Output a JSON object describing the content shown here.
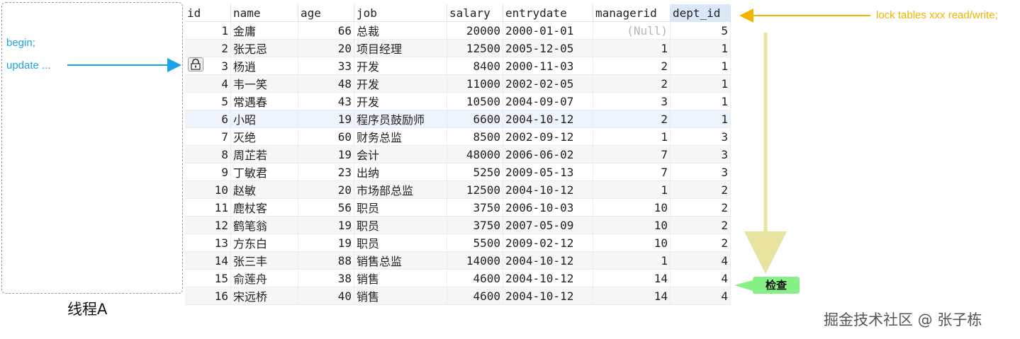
{
  "thread": {
    "label": "线程A",
    "notes": [
      "begin;",
      "update ..."
    ]
  },
  "annotation": {
    "lock_text": "lock tables xxx read/write;",
    "check_label": "检查"
  },
  "watermark": "掘金技术社区 @ 张子栋",
  "colors": {
    "thread_note": "#1aa3e8",
    "lock_arrow": "#f1b400",
    "check_arrow": "#e8e4a0",
    "check_bg": "#86f286"
  },
  "table": {
    "columns": [
      "id",
      "name",
      "age",
      "job",
      "salary",
      "entrydate",
      "managerid",
      "dept_id"
    ],
    "selected_column": "dept_id",
    "locked_row_index": 2,
    "rows": [
      [
        "1",
        "金庸",
        "66",
        "总裁",
        "20000",
        "2000-01-01",
        "(Null)",
        "5"
      ],
      [
        "2",
        "张无忌",
        "20",
        "项目经理",
        "12500",
        "2005-12-05",
        "1",
        "1"
      ],
      [
        "3",
        "杨逍",
        "33",
        "开发",
        "8400",
        "2000-11-03",
        "2",
        "1"
      ],
      [
        "4",
        "韦一笑",
        "48",
        "开发",
        "11000",
        "2002-02-05",
        "2",
        "1"
      ],
      [
        "5",
        "常遇春",
        "43",
        "开发",
        "10500",
        "2004-09-07",
        "3",
        "1"
      ],
      [
        "6",
        "小昭",
        "19",
        "程序员鼓励师",
        "6600",
        "2004-10-12",
        "2",
        "1"
      ],
      [
        "7",
        "灭绝",
        "60",
        "财务总监",
        "8500",
        "2002-09-12",
        "1",
        "3"
      ],
      [
        "8",
        "周芷若",
        "19",
        "会计",
        "48000",
        "2006-06-02",
        "7",
        "3"
      ],
      [
        "9",
        "丁敏君",
        "23",
        "出纳",
        "5250",
        "2009-05-13",
        "7",
        "3"
      ],
      [
        "10",
        "赵敏",
        "20",
        "市场部总监",
        "12500",
        "2004-10-12",
        "1",
        "2"
      ],
      [
        "11",
        "鹿杖客",
        "56",
        "职员",
        "3750",
        "2006-10-03",
        "10",
        "2"
      ],
      [
        "12",
        "鹤笔翁",
        "19",
        "职员",
        "3750",
        "2007-05-09",
        "10",
        "2"
      ],
      [
        "13",
        "方东白",
        "19",
        "职员",
        "5500",
        "2009-02-12",
        "10",
        "2"
      ],
      [
        "14",
        "张三丰",
        "88",
        "销售总监",
        "14000",
        "2004-10-12",
        "1",
        "4"
      ],
      [
        "15",
        "俞莲舟",
        "38",
        "销售",
        "4600",
        "2004-10-12",
        "14",
        "4"
      ],
      [
        "16",
        "宋远桥",
        "40",
        "销售",
        "4600",
        "2004-10-12",
        "14",
        "4"
      ]
    ]
  }
}
